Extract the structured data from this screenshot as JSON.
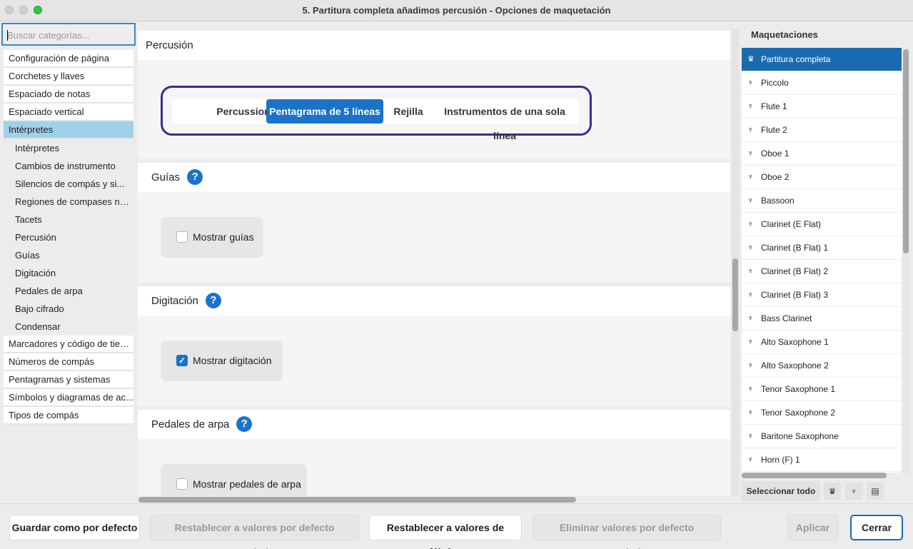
{
  "window": {
    "title": "5. Partitura completa añadimos percusión - Opciones de maquetación"
  },
  "sidebar": {
    "search_placeholder": "Buscar categorías...",
    "categories_top": [
      "Configuración de página",
      "Corchetes y llaves",
      "Espaciado de notas",
      "Espaciado vertical"
    ],
    "active_category": "Intérpretes",
    "subitems": [
      "Intérpretes",
      "Cambios de instrumento",
      "Silencios de compás y si...",
      "Regiones de compases num...",
      "Tacets",
      "Percusión",
      "Guías",
      "Digitación",
      "Pedales de arpa",
      "Bajo cifrado",
      "Condensar"
    ],
    "categories_bottom": [
      "Marcadores y código de tiem...",
      "Números de compás",
      "Pentagramas y sistemas",
      "Símbolos y diagramas de ac...",
      "Tipos de compás"
    ]
  },
  "main": {
    "percussion": {
      "title": "Percusión",
      "segment_label": "Percussion",
      "options": [
        "Pentagrama de 5 líneas",
        "Rejilla",
        "Instrumentos de una sola línea"
      ],
      "selected": "Pentagrama de 5 líneas"
    },
    "cues": {
      "title": "Guías",
      "checkbox_label": "Mostrar guías",
      "checked": false
    },
    "fingering": {
      "title": "Digitación",
      "checkbox_label": "Mostrar digitación",
      "checked": true
    },
    "harp": {
      "title": "Pedales de arpa",
      "checkbox_label": "Mostrar pedales de arpa",
      "checked": false
    },
    "help_glyph": "?"
  },
  "right_panel": {
    "title": "Maquetaciones",
    "layouts": [
      "Partitura completa",
      "Piccolo",
      "Flute 1",
      "Flute 2",
      "Oboe 1",
      "Oboe 2",
      "Bassoon",
      "Clarinet (E Flat)",
      "Clarinet (B Flat) 1",
      "Clarinet (B Flat) 2",
      "Clarinet (B Flat) 3",
      "Bass Clarinet",
      "Alto Saxophone 1",
      "Alto Saxophone 2",
      "Tenor Saxophone 1",
      "Tenor Saxophone 2",
      "Baritone Saxophone",
      "Horn (F) 1"
    ],
    "selected": "Partitura completa",
    "select_all": "Seleccionar todo",
    "icons": [
      "full-score-icon",
      "part-icon",
      "custom-layout-icon"
    ]
  },
  "footer": {
    "save_default": "Guardar como por defecto",
    "reset_saved": "Restablecer a valores por defecto guardados",
    "reset_factory": "Restablecer a valores de fábrica",
    "delete_saved": "Eliminar valores por defecto guardados",
    "apply": "Aplicar",
    "close": "Cerrar"
  },
  "colors": {
    "accent": "#1a73c9",
    "selection": "#1a6aaf",
    "category_active": "#9fd1ea",
    "focus_ring": "#3f2a9b"
  }
}
